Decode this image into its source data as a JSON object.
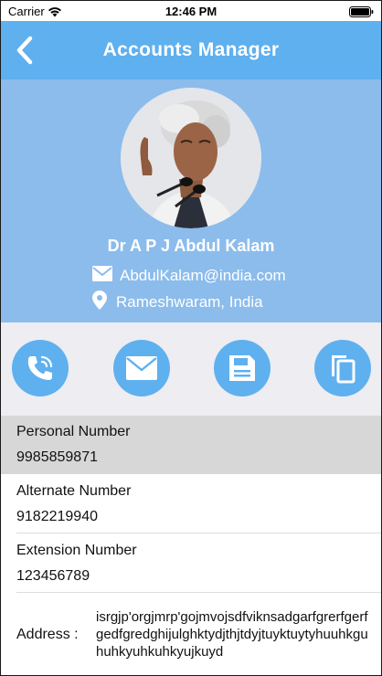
{
  "status_bar": {
    "carrier": "Carrier",
    "time": "12:46 PM"
  },
  "nav": {
    "title": "Accounts Manager",
    "back_icon": "chevron-left-icon"
  },
  "profile": {
    "name": "Dr A P J Abdul Kalam",
    "email": "AbdulKalam@india.com",
    "location": "Rameshwaram, India"
  },
  "actions": [
    {
      "icon": "phone-icon"
    },
    {
      "icon": "mail-icon"
    },
    {
      "icon": "save-icon"
    },
    {
      "icon": "copy-icon"
    }
  ],
  "details": [
    {
      "label": "Personal Number",
      "value": "9985859871",
      "selected": true
    },
    {
      "label": "Alternate Number",
      "value": "9182219940",
      "selected": false
    },
    {
      "label": "Extension Number",
      "value": "123456789",
      "selected": false
    }
  ],
  "address": {
    "label": "Address :",
    "value": "isrgjp'orgjmrp'gojmvojsdfviknsadgarfgrerfgerfgedfgredghijulghktydjthjtdyjtuyktuytyhuuhkguhuhkyuhkuhkyujkuyd"
  },
  "colors": {
    "nav_blue": "#5fb0ef",
    "profile_blue": "#8bbcec",
    "action_bg": "#ededf2",
    "selected_row": "#d7d7d7"
  }
}
